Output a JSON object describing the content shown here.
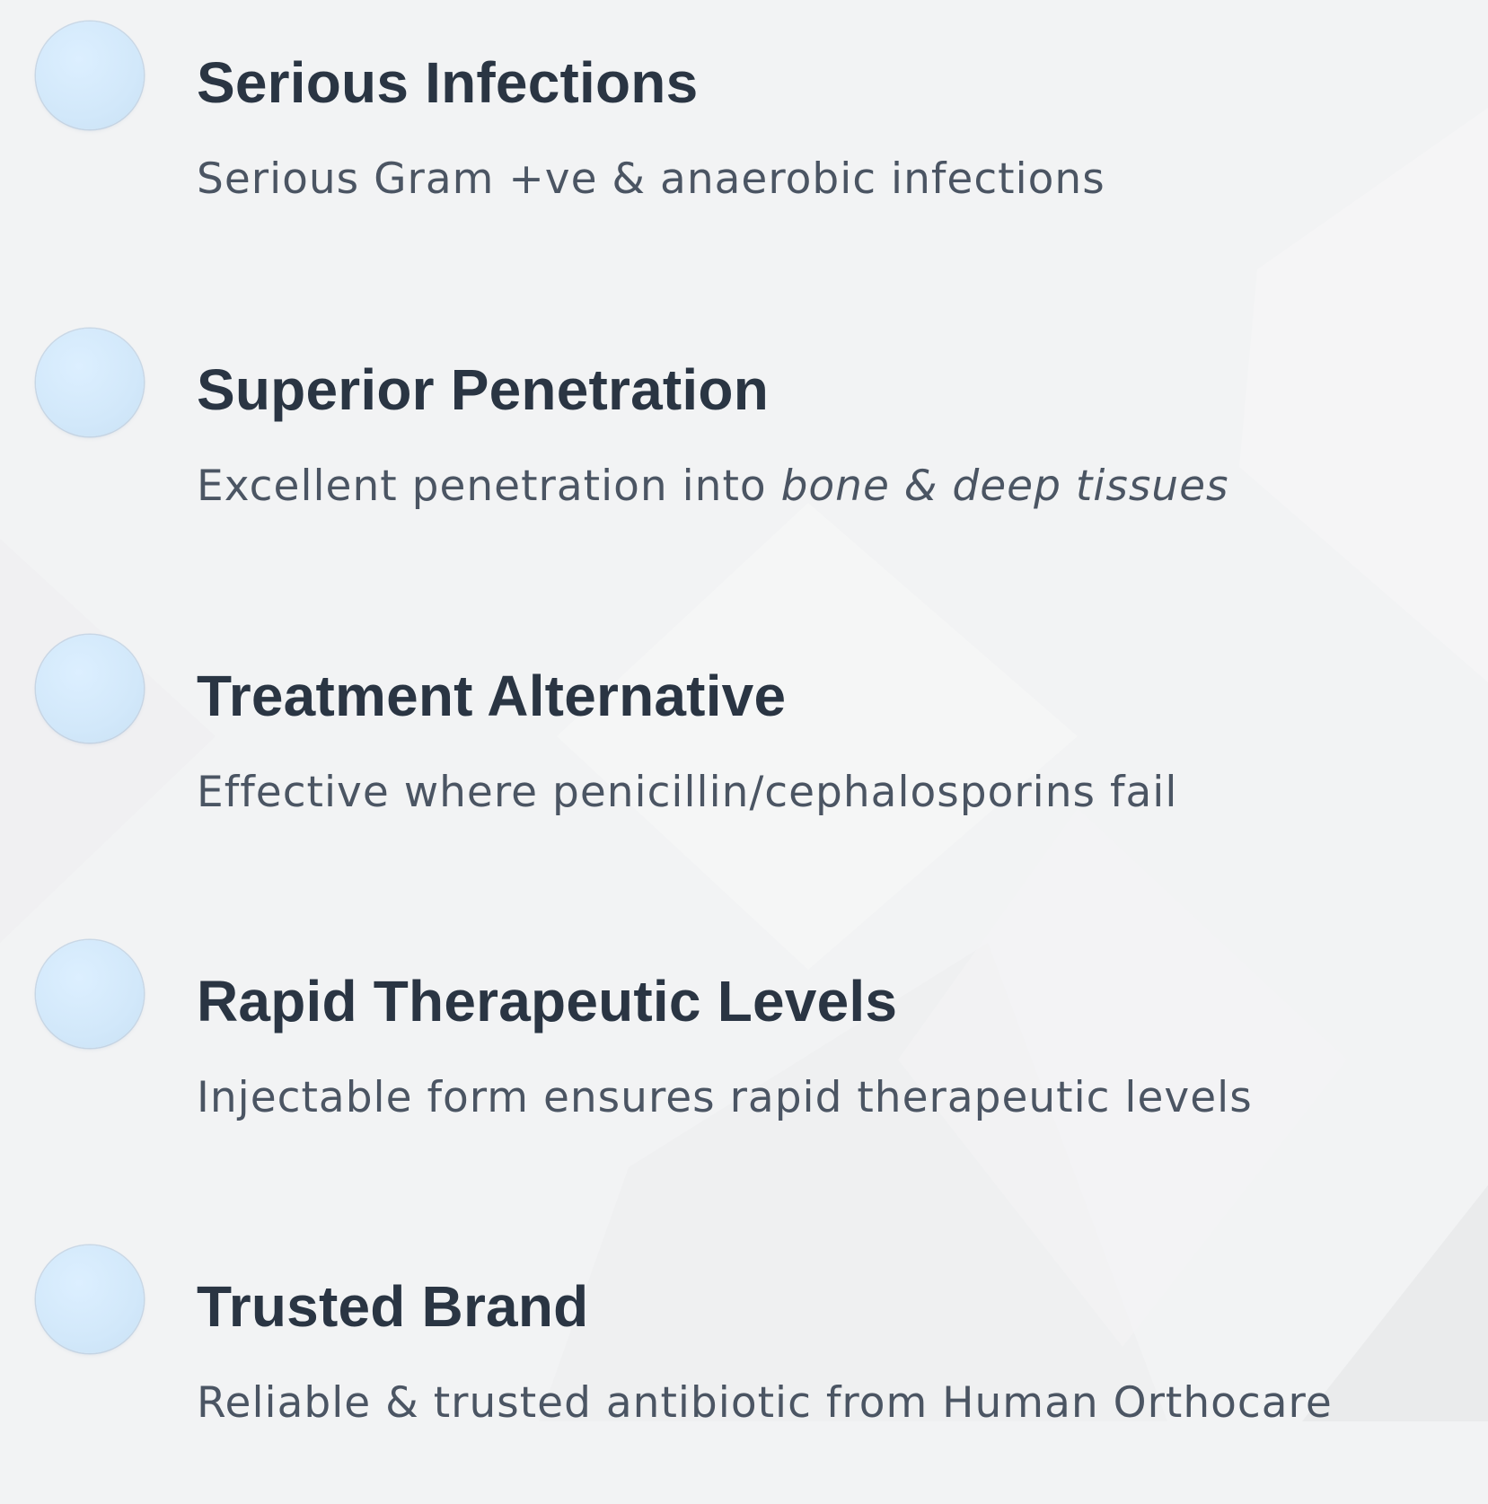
{
  "features": [
    {
      "title": "Serious Infections",
      "description": "Serious Gram +ve & anaerobic infections"
    },
    {
      "title": "Superior Penetration",
      "description_prefix": "Excellent penetration into ",
      "description_emphasis": "bone & deep tissues"
    },
    {
      "title": "Treatment Alternative",
      "description": "Effective where penicillin/cephalosporins fail"
    },
    {
      "title": "Rapid Therapeutic Levels",
      "description": "Injectable form ensures rapid therapeutic levels"
    },
    {
      "title": "Trusted Brand",
      "description": "Reliable & trusted antibiotic from Human Orthocare"
    }
  ],
  "colors": {
    "background": "#f2f3f4",
    "bullet": "#d2e8fa",
    "title": "#2a3543",
    "description": "#4b5563"
  }
}
